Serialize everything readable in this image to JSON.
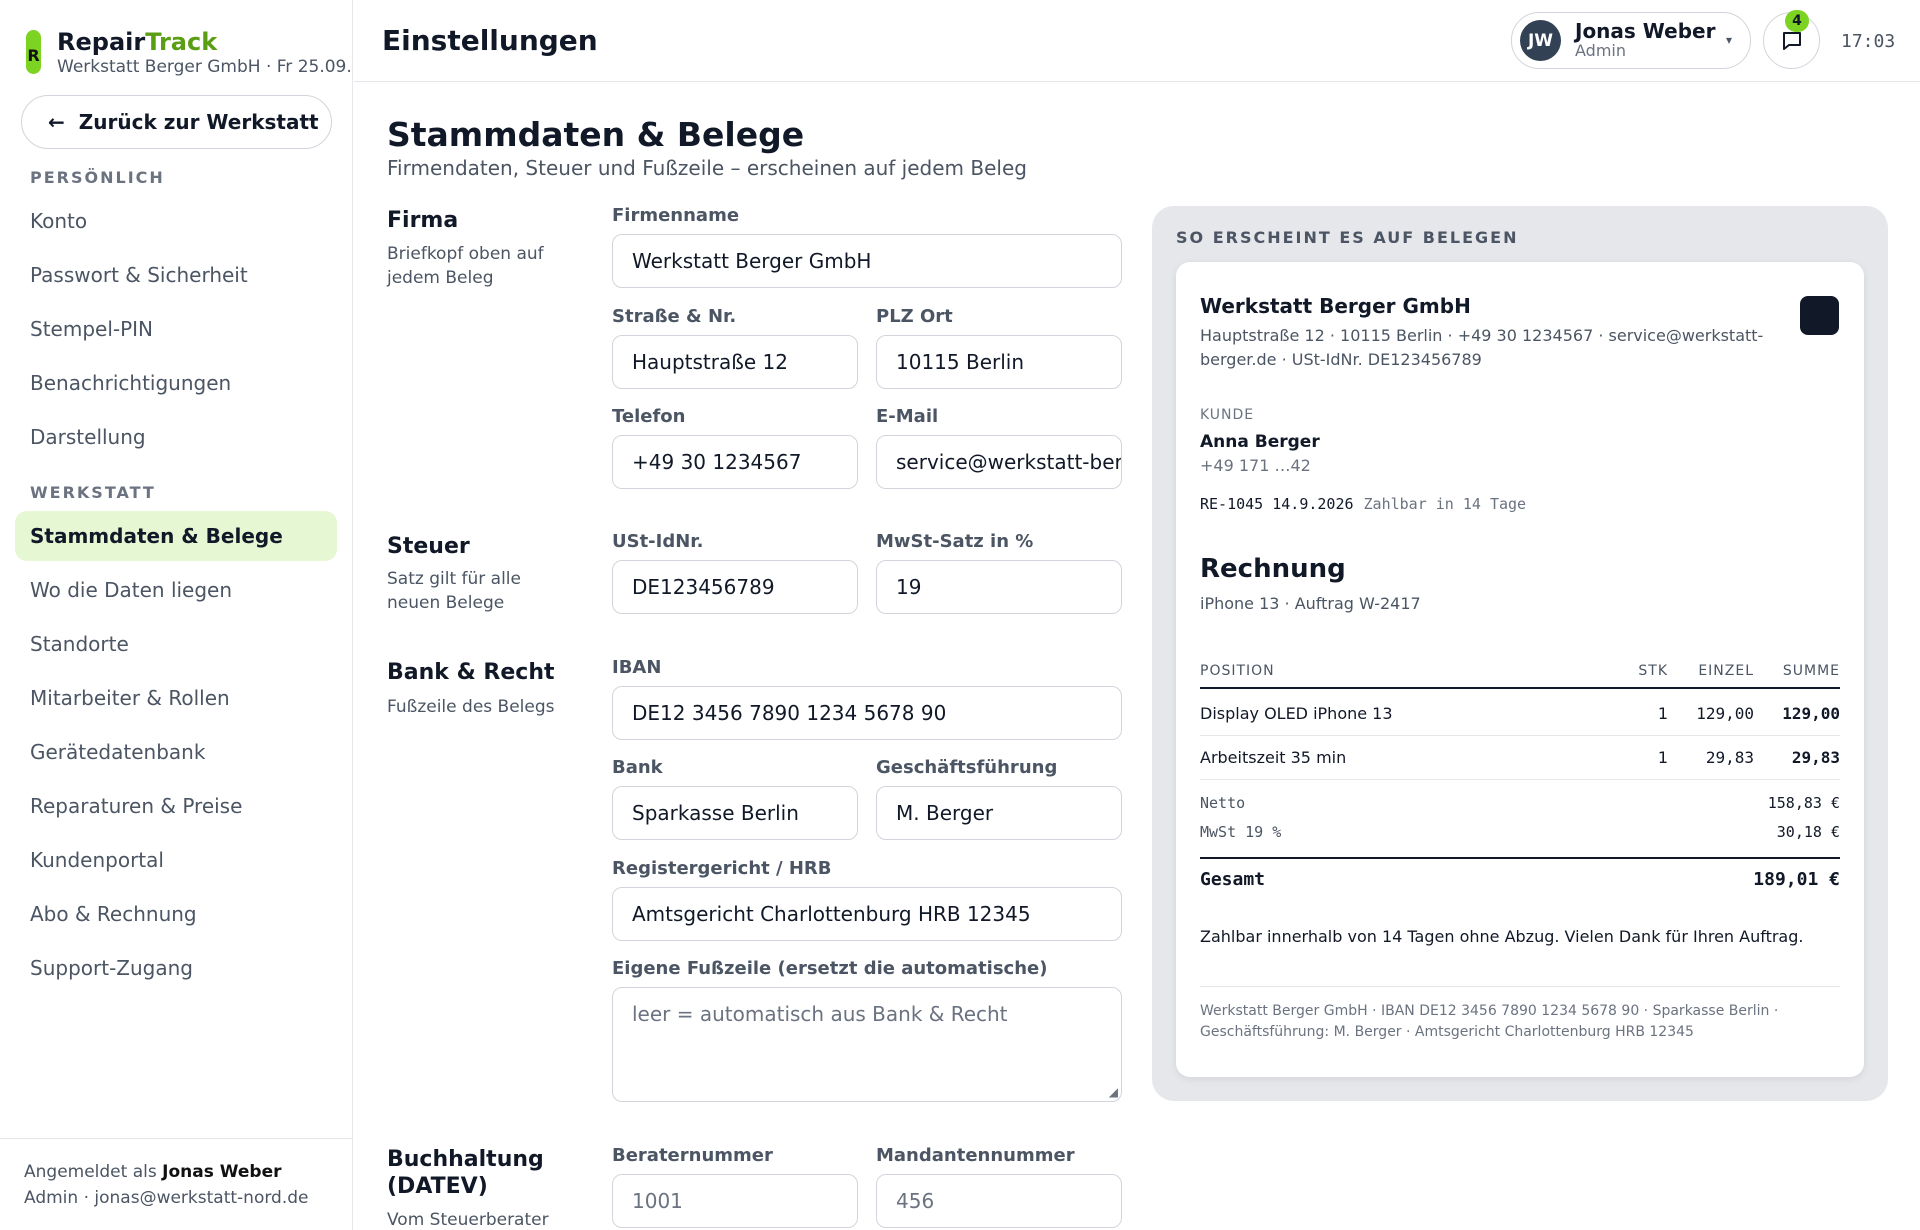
{
  "brand": {
    "logo_letter": "R",
    "name_a": "Repair",
    "name_b": "Track",
    "subtitle": "Werkstatt Berger GmbH · Fr 25.09.",
    "accent_color": "#7dd321"
  },
  "back_button": {
    "arrow": "←",
    "label": "Zurück zur Werkstatt"
  },
  "nav": {
    "section_personal": "PERSÖNLICH",
    "personal": [
      "Konto",
      "Passwort & Sicherheit",
      "Stempel-PIN",
      "Benachrichtigungen",
      "Darstellung"
    ],
    "section_workshop": "WERKSTATT",
    "workshop": [
      "Stammdaten & Belege",
      "Wo die Daten liegen",
      "Standorte",
      "Mitarbeiter & Rollen",
      "Gerätedatenbank",
      "Reparaturen & Preise",
      "Kundenportal",
      "Abo & Rechnung",
      "Support-Zugang"
    ],
    "active": "Stammdaten & Belege"
  },
  "footer": {
    "prefix": "Angemeldet als ",
    "user": "Jonas Weber",
    "line2": "Admin · jonas@werkstatt-nord.de"
  },
  "header": {
    "title": "Einstellungen",
    "user": {
      "initials": "JW",
      "name": "Jonas Weber",
      "role": "Admin",
      "caret": "▾"
    },
    "notifications": "4",
    "time": "17:03"
  },
  "page": {
    "title": "Stammdaten & Belege",
    "subtitle": "Firmendaten, Steuer und Fußzeile – erscheinen auf jedem Beleg"
  },
  "sections": {
    "firma": {
      "title": "Firma",
      "desc": "Briefkopf oben auf jedem Beleg"
    },
    "steuer": {
      "title": "Steuer",
      "desc": "Satz gilt für alle neuen Belege"
    },
    "bank": {
      "title": "Bank & Recht",
      "desc": "Fußzeile des Belegs"
    },
    "buchhaltung": {
      "title": "Buchhaltung (DATEV)",
      "desc": "Vom Steuerberater"
    }
  },
  "fields": {
    "firmenname": {
      "label": "Firmenname",
      "value": "Werkstatt Berger GmbH"
    },
    "strasse": {
      "label": "Straße & Nr.",
      "value": "Hauptstraße 12"
    },
    "plz": {
      "label": "PLZ Ort",
      "value": "10115 Berlin"
    },
    "telefon": {
      "label": "Telefon",
      "value": "+49 30 1234567"
    },
    "email": {
      "label": "E-Mail",
      "value": "service@werkstatt-berger.de"
    },
    "ust": {
      "label": "USt-IdNr.",
      "value": "DE123456789"
    },
    "mwst": {
      "label": "MwSt-Satz in %",
      "value": "19"
    },
    "iban": {
      "label": "IBAN",
      "value": "DE12 3456 7890 1234 5678 90"
    },
    "bank": {
      "label": "Bank",
      "value": "Sparkasse Berlin"
    },
    "gf": {
      "label": "Geschäftsführung",
      "value": "M. Berger"
    },
    "register": {
      "label": "Registergericht / HRB",
      "value": "Amtsgericht Charlottenburg HRB 12345"
    },
    "fusszeile": {
      "label": "Eigene Fußzeile (ersetzt die automatische)",
      "placeholder": "leer = automatisch aus Bank & Recht"
    },
    "berater": {
      "label": "Beraternummer",
      "placeholder": "1001"
    },
    "mandant": {
      "label": "Mandantennummer",
      "placeholder": "456"
    }
  },
  "preview": {
    "label": "SO ERSCHEINT ES AUF BELEGEN",
    "company": "Werkstatt Berger GmbH",
    "address": "Hauptstraße 12 · 10115 Berlin · +49 30 1234567 · service@werkstatt-berger.de · USt-IdNr. DE123456789",
    "kunde_label": "KUNDE",
    "kunde_name": "Anna Berger",
    "kunde_phone": "+49 171 …42",
    "invoice_no": "RE-1045",
    "invoice_date": "14.9.2026",
    "pay_terms": "Zahlbar in 14 Tage",
    "doc_title": "Rechnung",
    "doc_sub": "iPhone 13 · Auftrag W-2417",
    "columns": {
      "pos": "POSITION",
      "stk": "STK",
      "einzel": "EINZEL",
      "summe": "SUMME"
    },
    "rows": [
      {
        "pos": "Display OLED iPhone 13",
        "stk": "1",
        "einzel": "129,00",
        "summe": "129,00"
      },
      {
        "pos": "Arbeitszeit 35 min",
        "stk": "1",
        "einzel": "29,83",
        "summe": "29,83"
      }
    ],
    "netto_label": "Netto",
    "netto": "158,83 €",
    "mwst_label": "MwSt 19 %",
    "mwst": "30,18 €",
    "total_label": "Gesamt",
    "total": "189,01 €",
    "note": "Zahlbar innerhalb von 14 Tagen ohne Abzug. Vielen Dank für Ihren Auftrag.",
    "footer": "Werkstatt Berger GmbH · IBAN DE12 3456 7890 1234 5678 90 · Sparkasse Berlin · Geschäftsführung: M. Berger · Amtsgericht Charlottenburg HRB 12345"
  }
}
